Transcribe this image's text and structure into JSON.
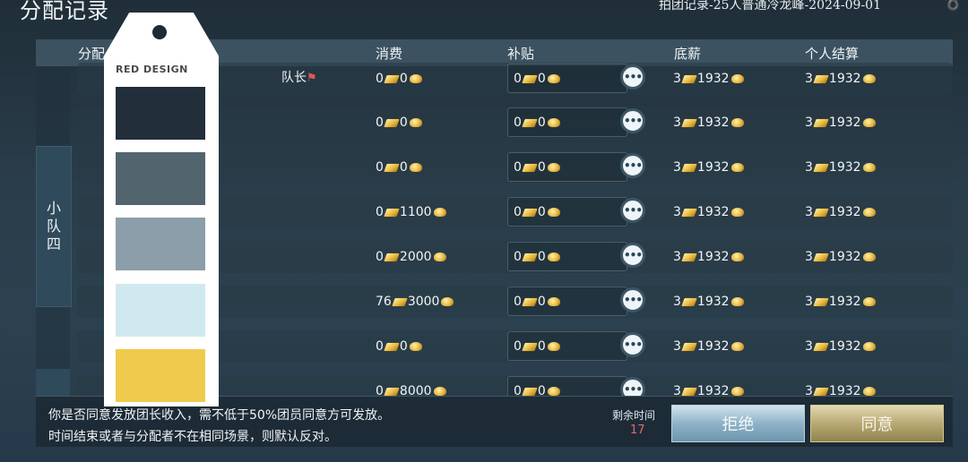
{
  "header": {
    "title": "分配记录",
    "subtitle": "拍团记录-25人普通冷龙峰-2024-09-01",
    "corner_icon": "swirl-icon"
  },
  "table": {
    "columns": [
      "分配",
      "消费",
      "补贴",
      "底薪",
      "个人结算"
    ],
    "squad_label": [
      "小",
      "队",
      "四"
    ],
    "leader_label": "队长",
    "rows": [
      {
        "consume_a": "0",
        "consume_b": "0",
        "subsidy_a": "0",
        "subsidy_b": "0",
        "base_a": "3",
        "base_b": "1932",
        "settle_a": "3",
        "settle_b": "1932",
        "leader": true
      },
      {
        "consume_a": "0",
        "consume_b": "0",
        "subsidy_a": "0",
        "subsidy_b": "0",
        "base_a": "3",
        "base_b": "1932",
        "settle_a": "3",
        "settle_b": "1932"
      },
      {
        "consume_a": "0",
        "consume_b": "0",
        "subsidy_a": "0",
        "subsidy_b": "0",
        "base_a": "3",
        "base_b": "1932",
        "settle_a": "3",
        "settle_b": "1932"
      },
      {
        "consume_a": "0",
        "consume_b": "1100",
        "subsidy_a": "0",
        "subsidy_b": "0",
        "base_a": "3",
        "base_b": "1932",
        "settle_a": "3",
        "settle_b": "1932"
      },
      {
        "consume_a": "0",
        "consume_b": "2000",
        "subsidy_a": "0",
        "subsidy_b": "0",
        "base_a": "3",
        "base_b": "1932",
        "settle_a": "3",
        "settle_b": "1932"
      },
      {
        "consume_a": "76",
        "consume_b": "3000",
        "subsidy_a": "0",
        "subsidy_b": "0",
        "base_a": "3",
        "base_b": "1932",
        "settle_a": "3",
        "settle_b": "1932"
      },
      {
        "consume_a": "0",
        "consume_b": "0",
        "subsidy_a": "0",
        "subsidy_b": "0",
        "base_a": "3",
        "base_b": "1932",
        "settle_a": "3",
        "settle_b": "1932"
      },
      {
        "consume_a": "0",
        "consume_b": "8000",
        "subsidy_a": "0",
        "subsidy_b": "0",
        "base_a": "3",
        "base_b": "1932",
        "settle_a": "3",
        "settle_b": "1932"
      }
    ]
  },
  "prompt": {
    "line1": "你是否同意发放团长收入，需不低于50%团员同意方可发放。",
    "line2": "时间结束或者与分配者不在相同场景，则默认反对。",
    "timer_label": "剩余时间",
    "timer_value": "17",
    "reject_label": "拒绝",
    "agree_label": "同意"
  },
  "overlay": {
    "brand": "RED DESIGN",
    "swatches": [
      "#222f3b",
      "#52656f",
      "#8b9ea9",
      "#d0e9f0",
      "#f0ca4c"
    ]
  }
}
